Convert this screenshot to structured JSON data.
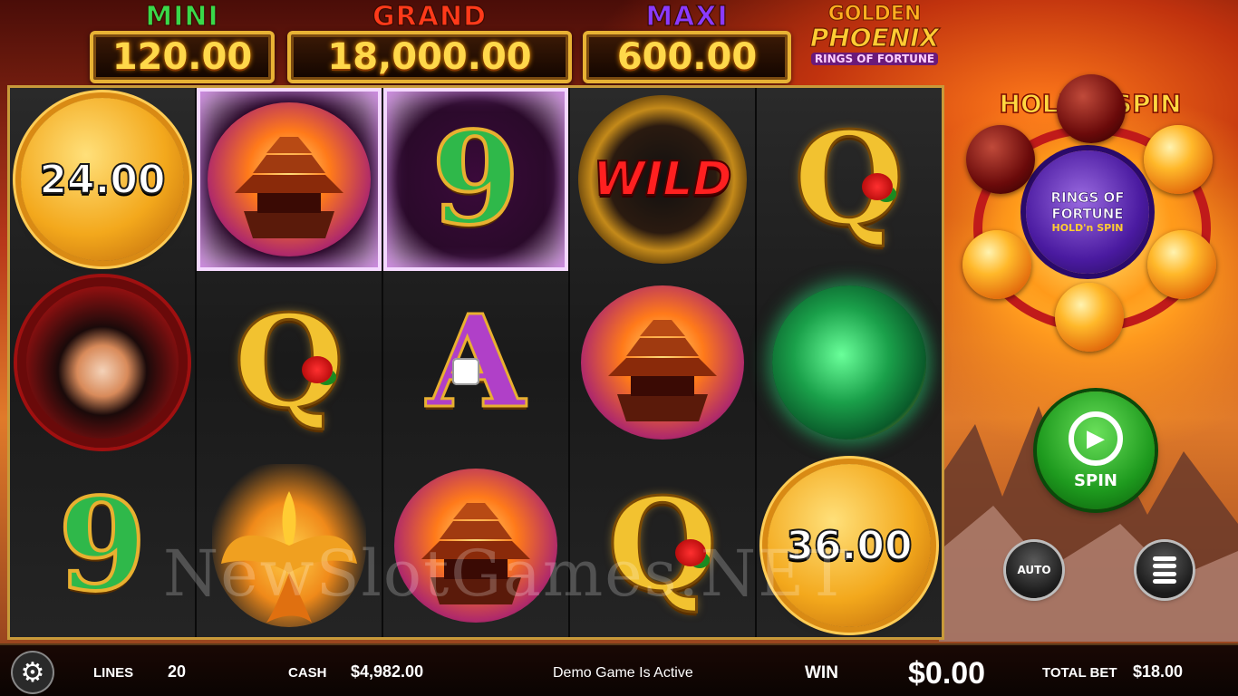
{
  "jackpots": [
    {
      "label": "MINI",
      "value": "120.00",
      "color": "#39d94a"
    },
    {
      "label": "GRAND",
      "value": "18,000.00",
      "color": "#ff3a1a"
    },
    {
      "label": "MAXI",
      "value": "600.00",
      "color": "#8a3aff"
    }
  ],
  "logo": {
    "line1": "GOLDEN",
    "line2": "PHOENIX",
    "line3": "RINGS OF FORTUNE"
  },
  "reels": [
    [
      {
        "symbol": "gold-coin",
        "value": "24.00"
      },
      {
        "symbol": "empress-portrait"
      },
      {
        "symbol": "nine",
        "text": "9"
      }
    ],
    [
      {
        "symbol": "temple",
        "held": true
      },
      {
        "symbol": "queen",
        "text": "Q"
      },
      {
        "symbol": "phoenix"
      }
    ],
    [
      {
        "symbol": "nine",
        "text": "9",
        "held": true
      },
      {
        "symbol": "ace",
        "text": "A"
      },
      {
        "symbol": "temple"
      }
    ],
    [
      {
        "symbol": "wild",
        "text": "WILD"
      },
      {
        "symbol": "temple"
      },
      {
        "symbol": "queen",
        "text": "Q"
      }
    ],
    [
      {
        "symbol": "queen",
        "text": "Q"
      },
      {
        "symbol": "jade-phoenix"
      },
      {
        "symbol": "gold-coin",
        "value": "36.00"
      }
    ]
  ],
  "hold_n_spin": {
    "title": "HOLD'n SPIN",
    "center_line1": "RINGS OF",
    "center_line2": "FORTUNE",
    "center_line3": "HOLD'n SPIN"
  },
  "controls": {
    "spin_label": "SPIN",
    "auto_label": "AUTO"
  },
  "watermark": "NewSlotGames.NET",
  "bottom_bar": {
    "lines_label": "LINES",
    "lines_value": "20",
    "cash_label": "CASH",
    "cash_value": "$4,982.00",
    "status": "Demo Game Is Active",
    "win_label": "WIN",
    "win_value": "$0.00",
    "total_bet_label": "TOTAL BET",
    "total_bet_value": "$18.00"
  }
}
